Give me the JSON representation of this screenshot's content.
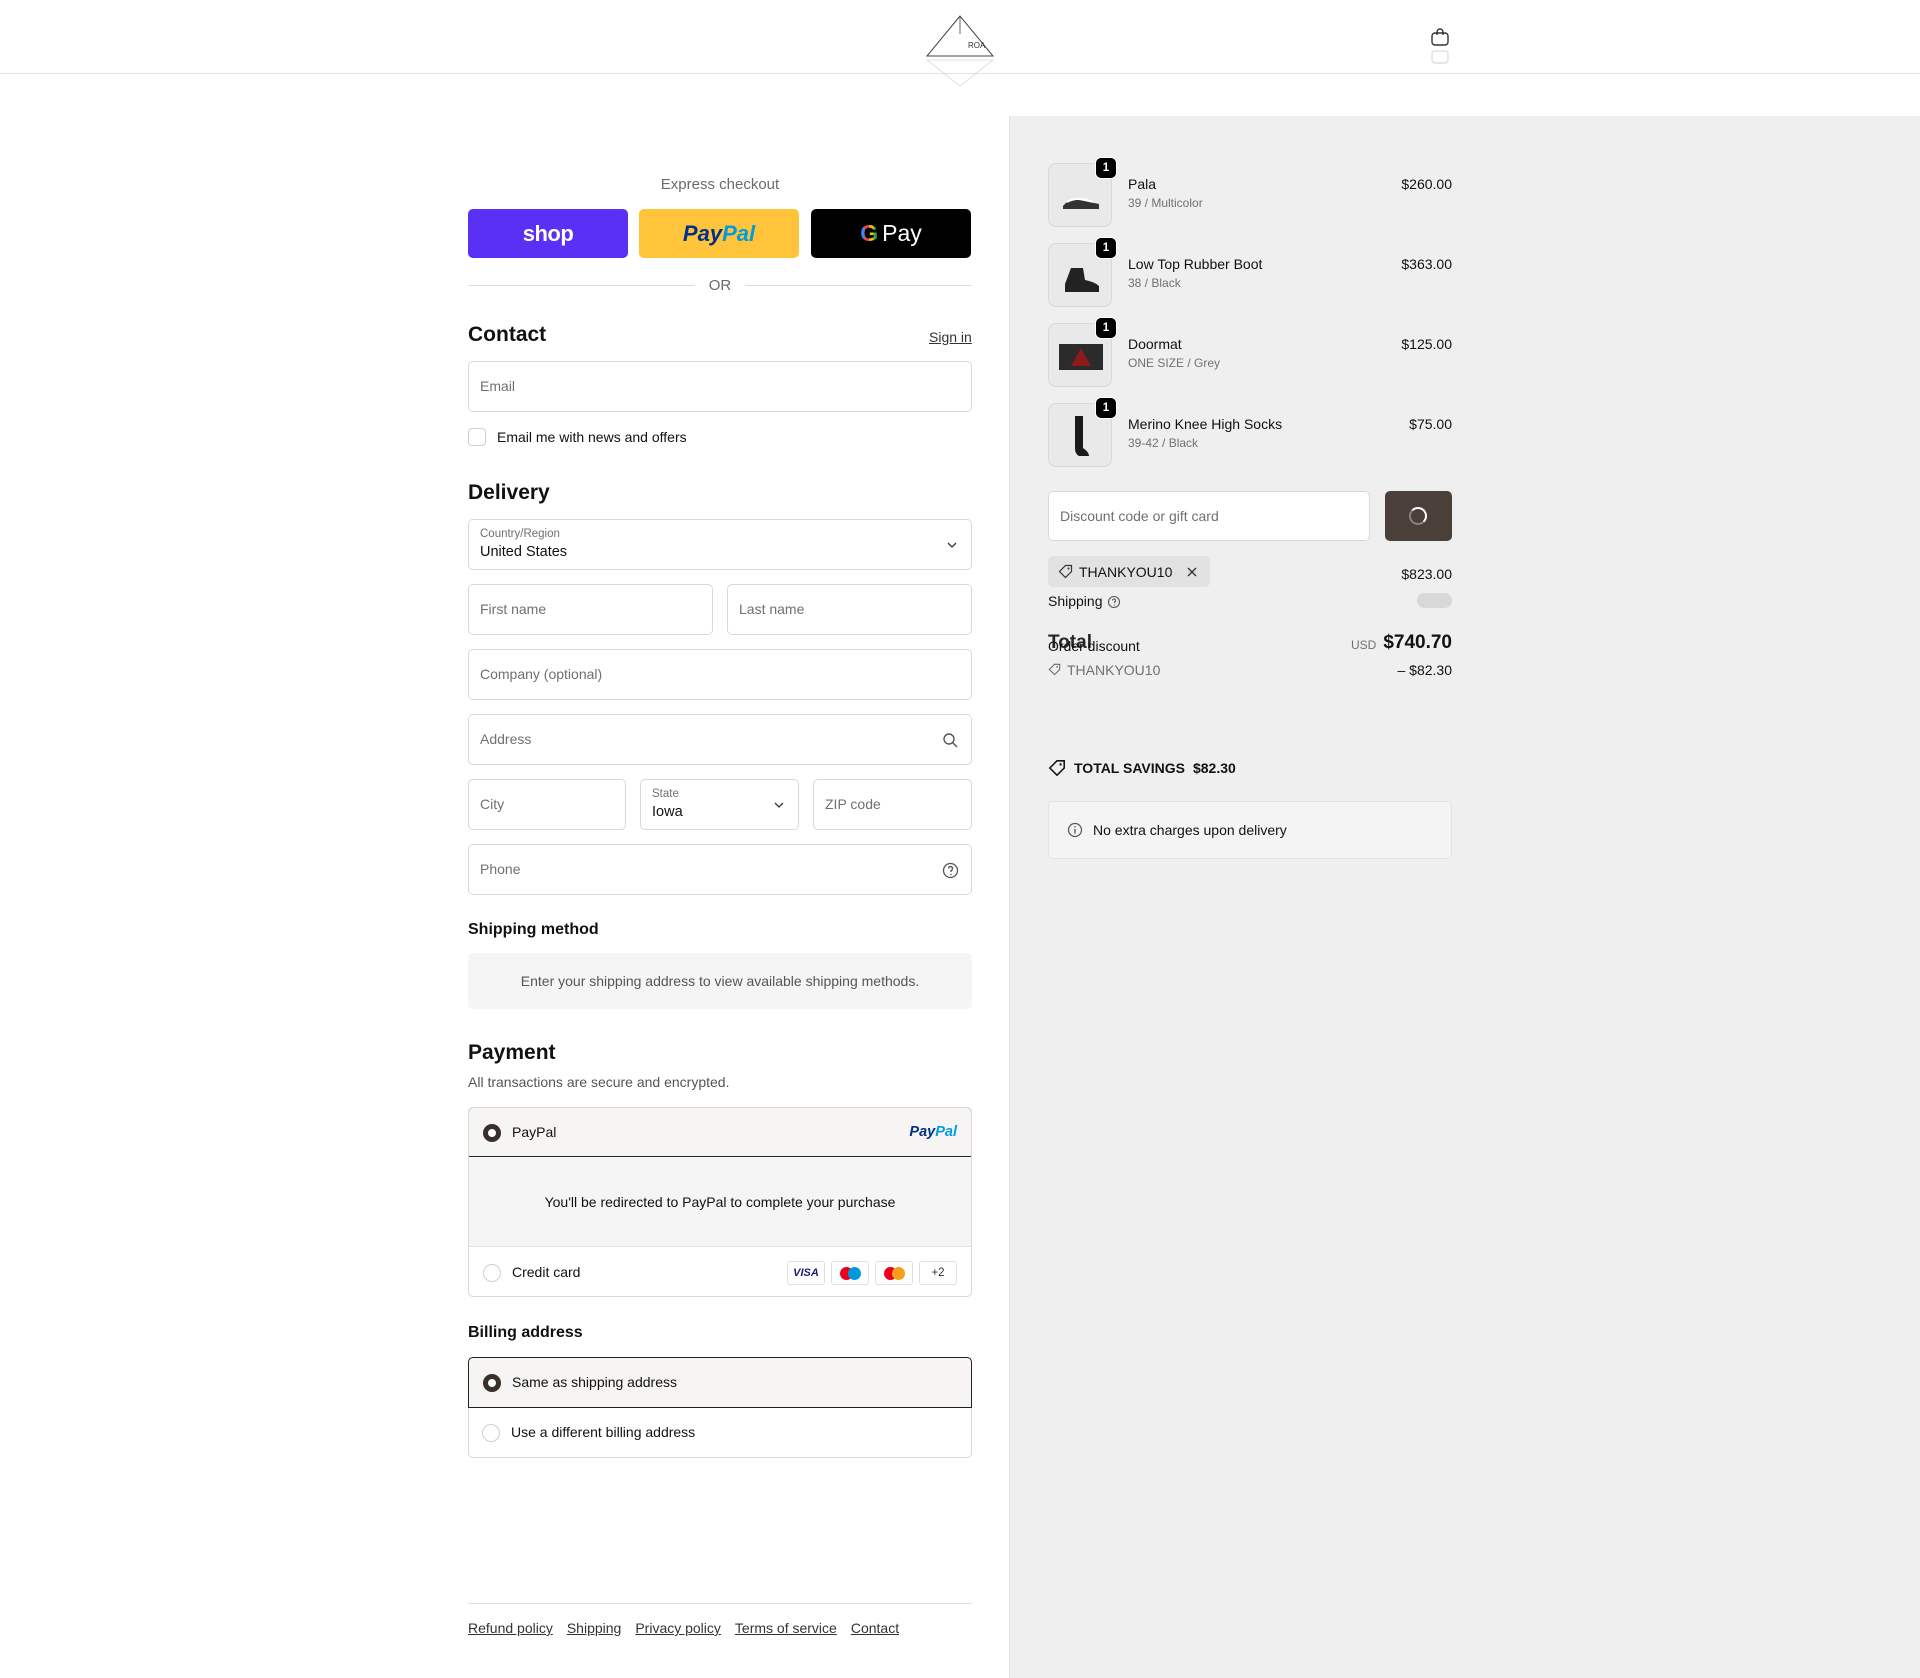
{
  "header": {
    "logo_name": "triangle-logo",
    "cart_icon": "bag-icon"
  },
  "express": {
    "title": "Express checkout",
    "shop_label": "shop",
    "paypal_label_a": "Pay",
    "paypal_label_b": "Pal",
    "gpay_label": "Pay",
    "gpay_g": "G",
    "or_label": "OR"
  },
  "contact": {
    "heading": "Contact",
    "sign_in": "Sign in",
    "email_placeholder": "Email",
    "newsletter_label": "Email me with news and offers"
  },
  "delivery": {
    "heading": "Delivery",
    "country_label": "Country/Region",
    "country_value": "United States",
    "first_name": "First name",
    "last_name": "Last name",
    "company": "Company (optional)",
    "address": "Address",
    "city": "City",
    "state_label": "State",
    "state_value": "Iowa",
    "zip": "ZIP code",
    "phone": "Phone"
  },
  "shipping_method": {
    "heading": "Shipping method",
    "info": "Enter your shipping address to view available shipping methods."
  },
  "payment": {
    "heading": "Payment",
    "subtitle": "All transactions are secure and encrypted.",
    "paypal_name": "PayPal",
    "paypal_logo_a": "Pay",
    "paypal_logo_b": "Pal",
    "redirect_text": "You'll be redirected to PayPal to complete your purchase",
    "credit_card": "Credit card",
    "card_visa": "VISA",
    "card_more": "+2",
    "selected": "PayPal"
  },
  "billing": {
    "heading": "Billing address",
    "same": "Same as shipping address",
    "different": "Use a different billing address",
    "selected": "Same as shipping address"
  },
  "footer": {
    "links": [
      "Refund policy",
      "Shipping",
      "Privacy policy",
      "Terms of service",
      "Contact"
    ]
  },
  "summary": {
    "products": [
      {
        "name": "Pala",
        "variant": "39 / Multicolor",
        "price": "$260.00",
        "qty": "1"
      },
      {
        "name": "Low Top Rubber Boot",
        "variant": "38 / Black",
        "price": "$363.00",
        "qty": "1"
      },
      {
        "name": "Doormat",
        "variant": "ONE SIZE / Grey",
        "price": "$125.00",
        "qty": "1"
      },
      {
        "name": "Merino Knee High Socks",
        "variant": "39-42 / Black",
        "price": "$75.00",
        "qty": "1"
      }
    ],
    "discount_placeholder": "Discount code or gift card",
    "applied_code": "THANKYOU10",
    "subtotal_value": "$823.00",
    "shipping_label": "Shipping",
    "order_discount_label": "Order discount",
    "discount_code_line": "THANKYOU10",
    "discount_amount": "– $82.30",
    "total_label": "Total",
    "currency": "USD",
    "total_value": "$740.70",
    "savings_label": "TOTAL SAVINGS",
    "savings_value": "$82.30",
    "note": "No extra charges upon delivery"
  }
}
